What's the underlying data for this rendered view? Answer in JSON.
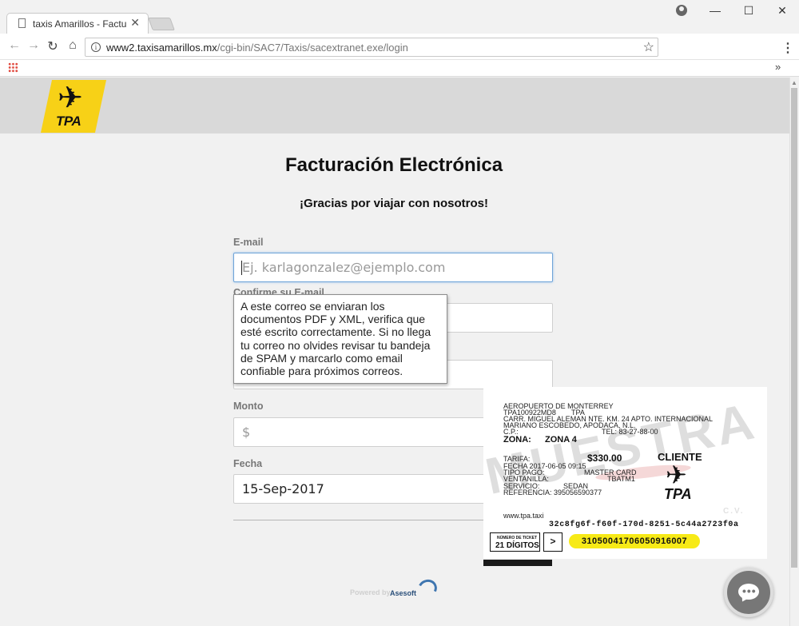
{
  "browser": {
    "tab_title": "taxis Amarillos - Facturac",
    "url_host": "www2.taxisamarillos.mx",
    "url_path": "/cgi-bin/SAC7/Taxis/sacextranet.exe/login"
  },
  "header": {
    "logo_text": "TPA",
    "brand_color": "#f7d117"
  },
  "main": {
    "title": "Facturación Electrónica",
    "subtitle": "¡Gracias por viajar con nosotros!"
  },
  "form": {
    "email_label": "E-mail",
    "email_placeholder": "Ej. karlagonzalez@ejemplo.com",
    "confirm_label": "Confirme su E-mail",
    "monto_label": "Monto",
    "monto_placeholder": "$",
    "fecha_label": "Fecha",
    "fecha_value": "15-Sep-2017"
  },
  "tooltip": {
    "text": "A este correo se enviaran los documentos PDF y XML, verifica que esté escrito correctamente. Si no llega tu correo no olvides revisar tu bandeja de SPAM y marcarlo como email confiable para próximos correos."
  },
  "ticket": {
    "line1": "AEROPUERTO DE MONTERREY",
    "line2_left": "TPA100922MD8",
    "line2_right": "TPA",
    "line3": "CARR. MIGUEL ALEMAN NTE. KM. 24  APTO. INTERNACIONAL",
    "line4": "MARIANO ESCOBEDO, APODACA, N.L.",
    "line5_left": "C.P.:",
    "line5_right": "TEL:  83-27-88-00",
    "zona_label": "ZONA:",
    "zona_value": "ZONA 4",
    "tarifa_label": "TARIFA:",
    "amount": "$330.00",
    "fecha_line": "FECHA 2017-06-05 09:15",
    "tipo_pago_label": "TIPO PAGO:",
    "tipo_pago_value": "MASTER CARD",
    "ventanilla_label": "VENTANILLA:",
    "ventanilla_value": "TBATM1",
    "servicio_label": "SERVICIO:",
    "servicio_value": "SEDAN",
    "referencia": "REFERENCIA: 395056590377",
    "cliente": "CLIENTE",
    "tpa": "TPA",
    "watermark": "MUESTRA",
    "watermark_small": "C.V.",
    "website": "www.tpa.taxi",
    "uuid": "32c8fg6f-f60f-170d-8251-5c44a2723f0a",
    "box_small": "NÚMERO DE TICKET",
    "box_big": "21 DÍGITOS",
    "arrow": ">",
    "ticket_number": "31050041706050916007",
    "highlight_color": "#f7ea17"
  },
  "footer": {
    "powered_by": "Powered by",
    "asesoft": "Asesoft"
  }
}
